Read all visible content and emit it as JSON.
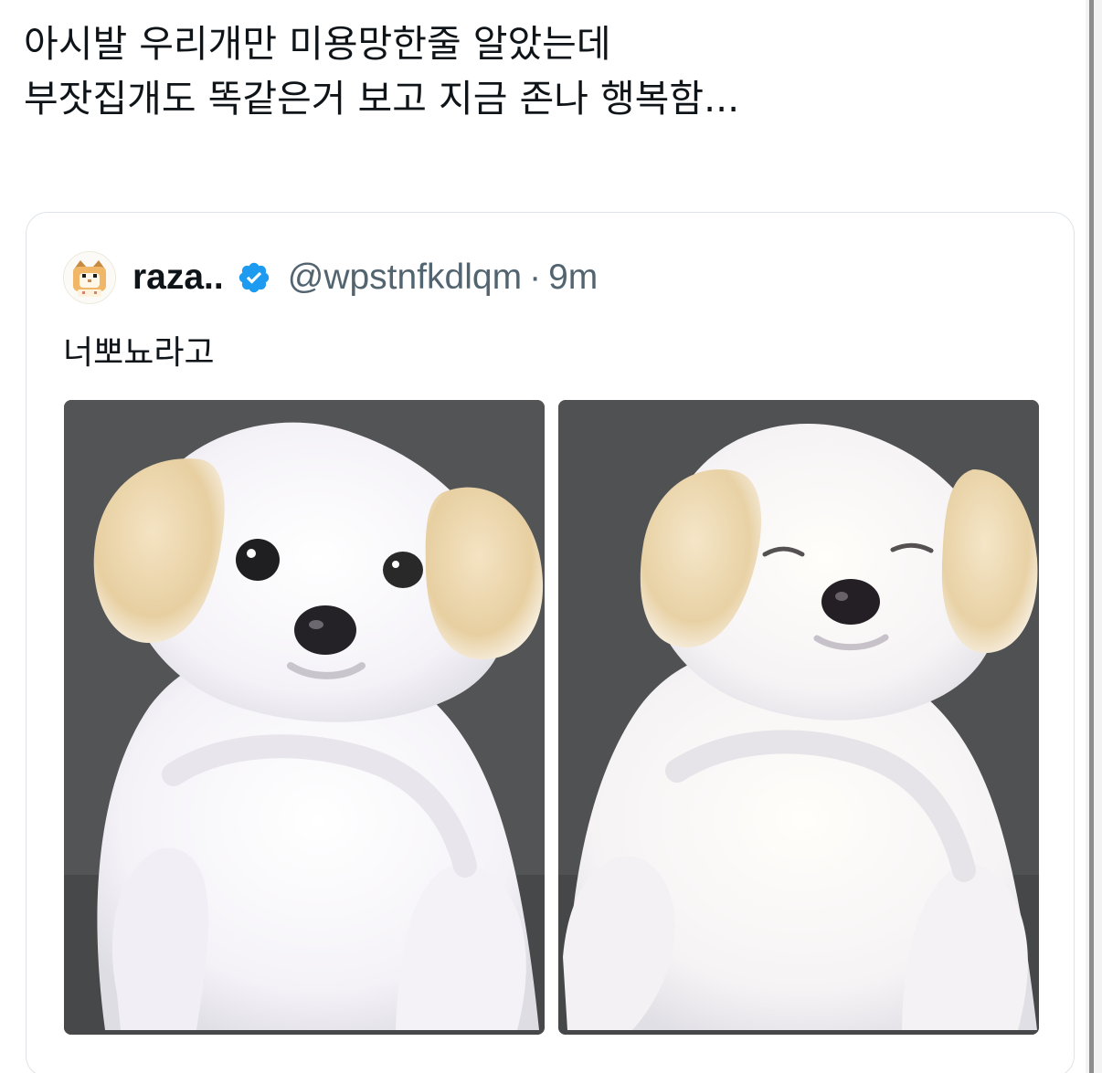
{
  "tweet": {
    "text_line_1": "아시발 우리개만 미용망한줄 알았는데",
    "text_line_2": "부잣집개도 똑같은거 보고 지금 존나 행복함..."
  },
  "quoted_tweet": {
    "avatar_icon": "hamster-avatar-icon",
    "display_name": "raza..",
    "verified_icon": "verified-badge-icon",
    "verified_color": "#1d9bf0",
    "handle": "@wpstnfkdlqm",
    "separator": "·",
    "time": "9m",
    "text": "너뽀뇨라고",
    "media": [
      {
        "name": "dog-photo-eyes-open",
        "depicts": "white fluffy dog with eyes open"
      },
      {
        "name": "dog-photo-eyes-closed",
        "depicts": "white fluffy dog with eyes closed"
      }
    ]
  },
  "colors": {
    "text_primary": "#0f1419",
    "text_secondary": "#536471",
    "card_border": "#dfe3e7",
    "photo_background": "#4f5052"
  }
}
